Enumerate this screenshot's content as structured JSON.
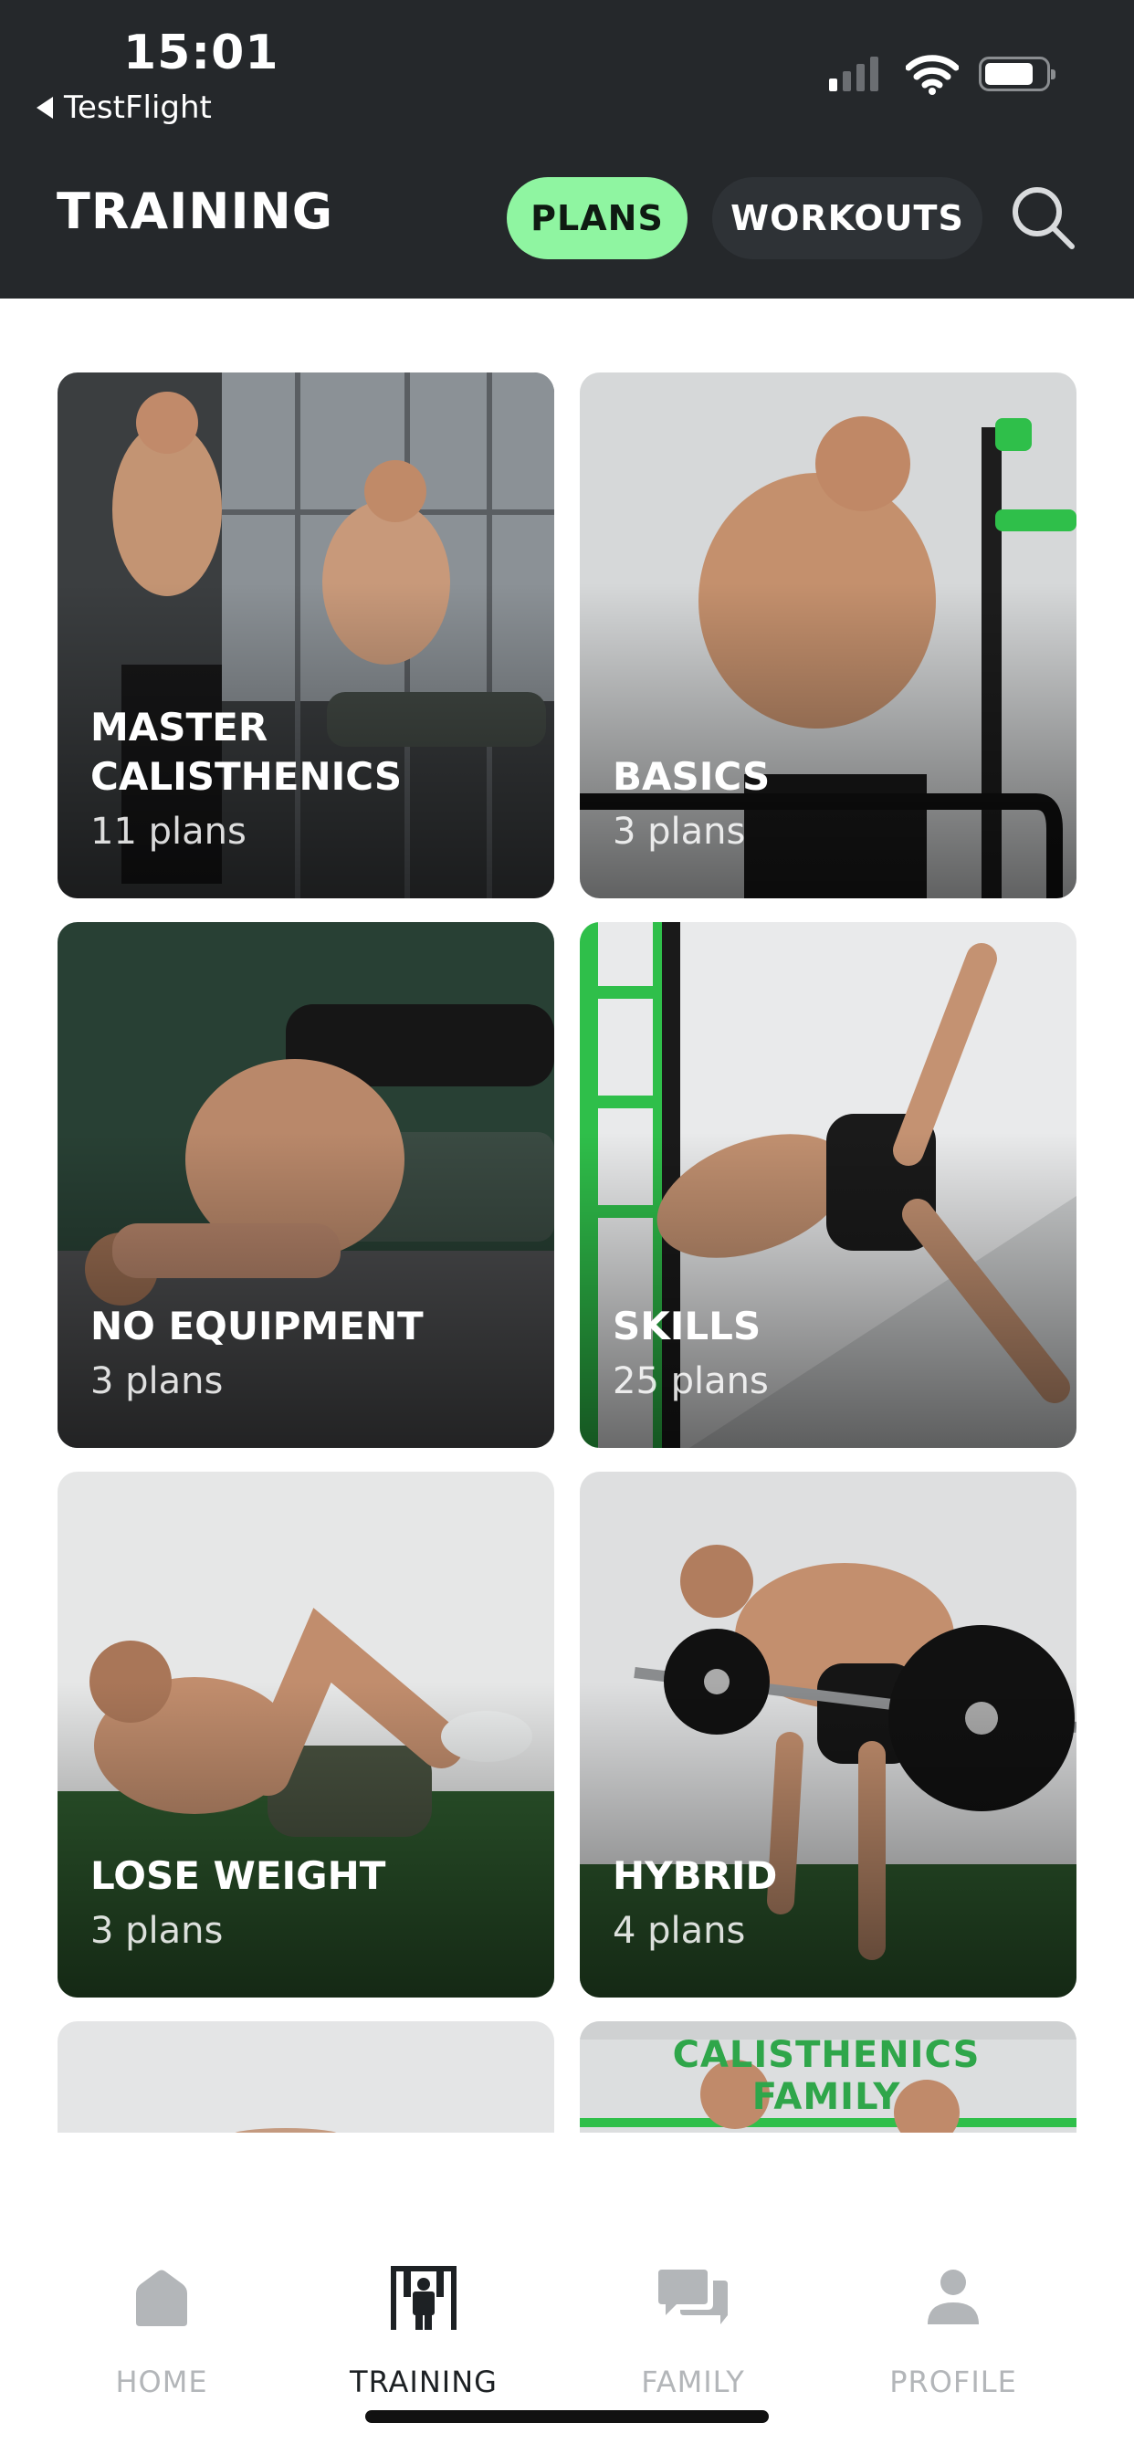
{
  "status": {
    "time": "15:01",
    "back_app": "TestFlight"
  },
  "header": {
    "title": "TRAINING",
    "tabs": [
      {
        "label": "PLANS",
        "active": true
      },
      {
        "label": "WORKOUTS",
        "active": false
      }
    ],
    "search_icon": "search-icon"
  },
  "colors": {
    "header_bg": "#25282b",
    "accent": "#8ff5a1",
    "inactive_tab": "#b3b6b9",
    "active_tab": "#1d2124"
  },
  "categories": [
    {
      "title": "MASTER CALISTHENICS",
      "count": "11 plans"
    },
    {
      "title": "BASICS",
      "count": "3 plans"
    },
    {
      "title": "NO EQUIPMENT",
      "count": "3 plans"
    },
    {
      "title": "SKILLS",
      "count": "25 plans"
    },
    {
      "title": "LOSE WEIGHT",
      "count": "3 plans"
    },
    {
      "title": "HYBRID",
      "count": "4 plans"
    }
  ],
  "partial_card_text": "CALISTHENICS FAMILY",
  "tabbar": [
    {
      "label": "HOME",
      "icon": "home-icon",
      "active": false
    },
    {
      "label": "TRAINING",
      "icon": "pullup-bar-icon",
      "active": true
    },
    {
      "label": "FAMILY",
      "icon": "chat-icon",
      "active": false
    },
    {
      "label": "PROFILE",
      "icon": "person-icon",
      "active": false
    }
  ]
}
